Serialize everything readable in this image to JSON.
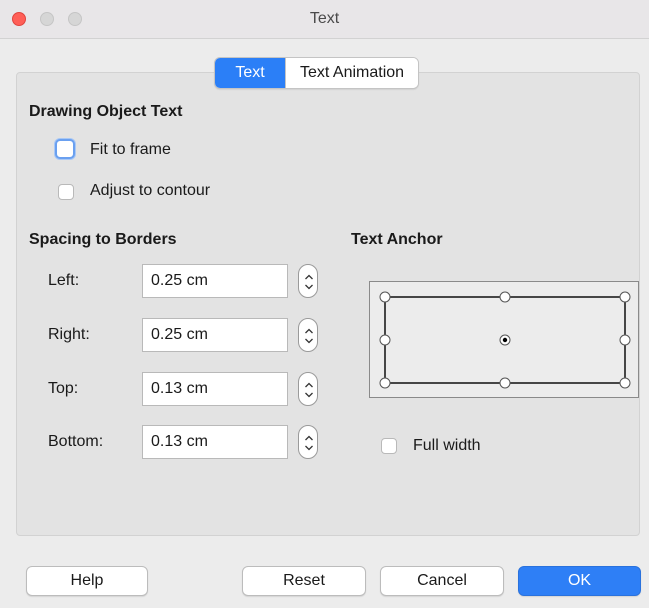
{
  "window": {
    "title": "Text"
  },
  "tabs": [
    {
      "label": "Text",
      "active": true
    },
    {
      "label": "Text Animation",
      "active": false
    }
  ],
  "drawing_object_text": {
    "heading": "Drawing Object Text",
    "fit_to_frame": {
      "label": "Fit to frame",
      "checked": false
    },
    "adjust_to_contour": {
      "label": "Adjust to contour",
      "checked": false
    }
  },
  "spacing": {
    "heading": "Spacing to Borders",
    "left": {
      "label": "Left:",
      "value": "0.25 cm"
    },
    "right": {
      "label": "Right:",
      "value": "0.25 cm"
    },
    "top": {
      "label": "Top:",
      "value": "0.13 cm"
    },
    "bottom": {
      "label": "Bottom:",
      "value": "0.13 cm"
    }
  },
  "text_anchor": {
    "heading": "Text Anchor",
    "selected": "center",
    "full_width": {
      "label": "Full width",
      "checked": false
    }
  },
  "buttons": {
    "help": "Help",
    "reset": "Reset",
    "cancel": "Cancel",
    "ok": "OK"
  },
  "colors": {
    "accent": "#2b7ff7",
    "close": "#ff5f57"
  }
}
